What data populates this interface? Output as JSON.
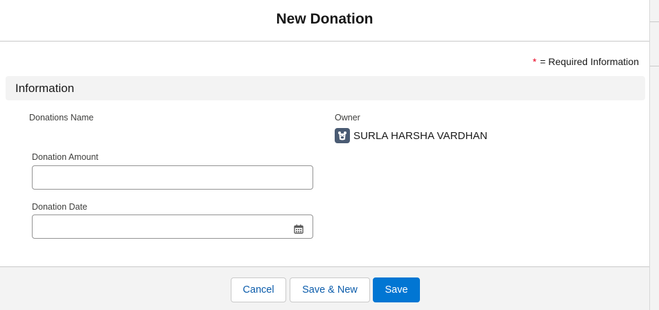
{
  "modal": {
    "title": "New Donation"
  },
  "required_note": {
    "star": "*",
    "text": "= Required Information"
  },
  "section": {
    "title": "Information"
  },
  "fields": {
    "donations_name_label": "Donations Name",
    "owner_label": "Owner",
    "owner_name": "SURLA HARSHA VARDHAN",
    "owner_avatar_icon": "user-avatar-icon",
    "donation_amount_label": "Donation Amount",
    "donation_amount_value": "",
    "donation_date_label": "Donation Date",
    "donation_date_value": "",
    "date_picker_icon": "calendar-icon"
  },
  "footer": {
    "cancel_label": "Cancel",
    "save_new_label": "Save & New",
    "save_label": "Save"
  },
  "colors": {
    "brand": "#0176d3",
    "neutral_text": "#0b5cab",
    "required": "#ea001e",
    "section_bg": "#f3f3f3"
  }
}
